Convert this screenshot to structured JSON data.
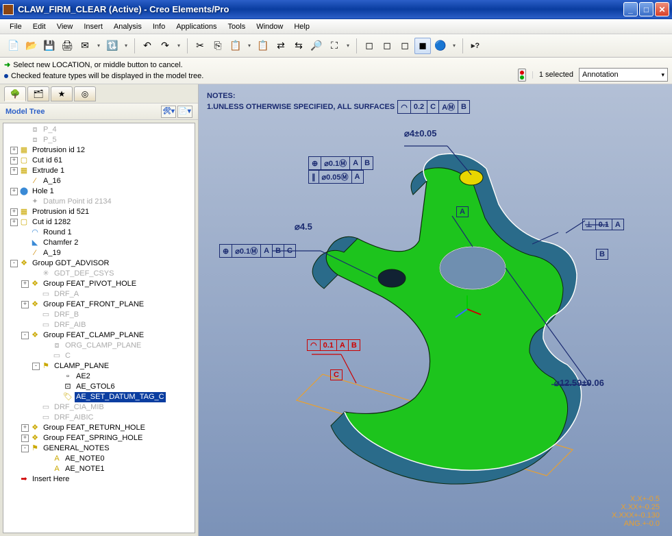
{
  "window": {
    "title": "CLAW_FIRM_CLEAR (Active) - Creo Elements/Pro"
  },
  "menu": [
    "File",
    "Edit",
    "View",
    "Insert",
    "Analysis",
    "Info",
    "Applications",
    "Tools",
    "Window",
    "Help"
  ],
  "messages": {
    "line1": "Select new LOCATION, or middle button to cancel.",
    "line2": "Checked feature types will be displayed in the model tree."
  },
  "selection": {
    "count": "1 selected",
    "filter": "Annotation"
  },
  "panel": {
    "title": "Model Tree"
  },
  "tree": [
    {
      "d": 1,
      "ic": "plane",
      "t": "P_4",
      "dim": true
    },
    {
      "d": 1,
      "ic": "plane",
      "t": "P_5",
      "dim": true
    },
    {
      "d": 0,
      "tg": "+",
      "ic": "prot",
      "t": "Protrusion id 12"
    },
    {
      "d": 0,
      "tg": "+",
      "ic": "cut",
      "t": "Cut id 61"
    },
    {
      "d": 0,
      "tg": "+",
      "ic": "prot",
      "t": "Extrude 1"
    },
    {
      "d": 1,
      "ic": "axis",
      "t": "A_16"
    },
    {
      "d": 0,
      "tg": "+",
      "ic": "hole",
      "t": "Hole 1"
    },
    {
      "d": 1,
      "ic": "pt",
      "t": "Datum Point id 2134",
      "dim": true
    },
    {
      "d": 0,
      "tg": "+",
      "ic": "prot",
      "t": "Protrusion id 521"
    },
    {
      "d": 0,
      "tg": "+",
      "ic": "cut",
      "t": "Cut id 1282"
    },
    {
      "d": 1,
      "ic": "rnd",
      "t": "Round 1"
    },
    {
      "d": 1,
      "ic": "chm",
      "t": "Chamfer 2"
    },
    {
      "d": 1,
      "ic": "axis",
      "t": "A_19"
    },
    {
      "d": 0,
      "tg": "-",
      "ic": "grp",
      "t": "Group GDT_ADVISOR"
    },
    {
      "d": 2,
      "ic": "csys",
      "t": "GDT_DEF_CSYS",
      "dim": true
    },
    {
      "d": 1,
      "tg": "+",
      "ic": "grp",
      "t": "Group FEAT_PIVOT_HOLE"
    },
    {
      "d": 2,
      "ic": "drf",
      "t": "DRF_A",
      "dim": true
    },
    {
      "d": 1,
      "tg": "+",
      "ic": "grp",
      "t": "Group FEAT_FRONT_PLANE"
    },
    {
      "d": 2,
      "ic": "drf",
      "t": "DRF_B",
      "dim": true
    },
    {
      "d": 2,
      "ic": "drf",
      "t": "DRF_AIB",
      "dim": true
    },
    {
      "d": 1,
      "tg": "-",
      "ic": "grp",
      "t": "Group FEAT_CLAMP_PLANE"
    },
    {
      "d": 3,
      "ic": "plane",
      "t": "ORG_CLAMP_PLANE",
      "dim": true
    },
    {
      "d": 3,
      "ic": "drf",
      "t": "C",
      "dim": true
    },
    {
      "d": 2,
      "tg": "-",
      "ic": "flag",
      "t": "CLAMP_PLANE"
    },
    {
      "d": 4,
      "ic": "ae",
      "t": "AE2"
    },
    {
      "d": 4,
      "ic": "gtol",
      "t": "AE_GTOL6"
    },
    {
      "d": 4,
      "ic": "dtag",
      "t": "AE_SET_DATUM_TAG_C",
      "sel": true
    },
    {
      "d": 2,
      "ic": "drf",
      "t": "DRF_CIA_MIB",
      "dim": true
    },
    {
      "d": 2,
      "ic": "drf",
      "t": "DRF_AIBIC",
      "dim": true
    },
    {
      "d": 1,
      "tg": "+",
      "ic": "grp",
      "t": "Group FEAT_RETURN_HOLE"
    },
    {
      "d": 1,
      "tg": "+",
      "ic": "grp",
      "t": "Group FEAT_SPRING_HOLE"
    },
    {
      "d": 1,
      "tg": "-",
      "ic": "flag",
      "t": "GENERAL_NOTES"
    },
    {
      "d": 3,
      "ic": "note",
      "t": "AE_NOTE0"
    },
    {
      "d": 3,
      "ic": "note",
      "t": "AE_NOTE1"
    },
    {
      "d": 0,
      "ic": "ins",
      "t": "Insert Here"
    }
  ],
  "viewport": {
    "notes_title": "NOTES:",
    "notes_line": "1.UNLESS OTHERWISE SPECIFIED, ALL SURFACES",
    "note_fcf": [
      "◠",
      "0.2",
      "C",
      "AⓂ",
      "B"
    ],
    "dim1": "⌀4±0.05",
    "fcf1a": [
      "⊕",
      "⌀0.1Ⓜ",
      "A",
      "B"
    ],
    "fcf1b": [
      "∥",
      "⌀0.05Ⓜ",
      "A"
    ],
    "dim2": "⌀4.5",
    "fcf2": [
      "⊕",
      "⌀0.1Ⓜ",
      "A",
      "B",
      "C"
    ],
    "datum_a": "A",
    "fcf3": [
      "⊥",
      "0.1",
      "A"
    ],
    "datum_b": "B",
    "fcf_red": [
      "◠",
      "0.1",
      "A",
      "B"
    ],
    "datum_c": "C",
    "dim3": "⌀12.59±0.06",
    "tol": [
      "X.X+-0.5",
      "X.XX+-0.25",
      "X.XXX+-0.130",
      "ANG.+-0.0"
    ]
  }
}
